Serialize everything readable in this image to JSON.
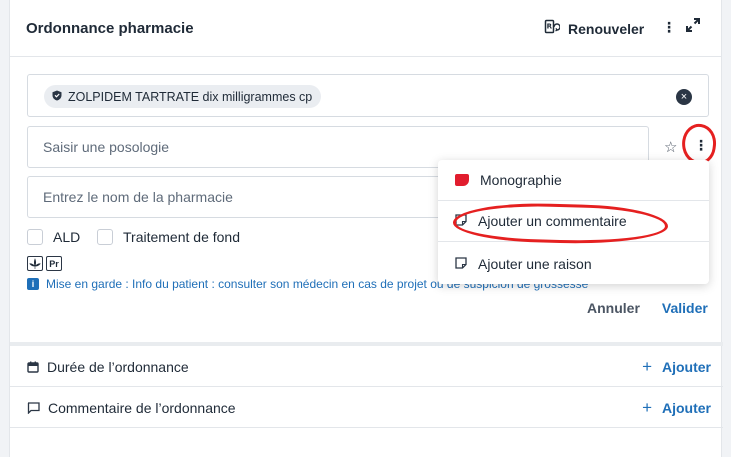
{
  "header": {
    "title": "Ordonnance pharmacie",
    "renew_label": "Renouveler"
  },
  "medication": {
    "name": "ZOLPIDEM TARTRATE dix milligrammes cp"
  },
  "posology": {
    "placeholder": "Saisir une posologie"
  },
  "pharmacy": {
    "placeholder": "Entrez le nom de la pharmacie"
  },
  "checkboxes": {
    "ald_label": "ALD",
    "fond_label": "Traitement de fond"
  },
  "badges": {
    "pr": "Pr"
  },
  "warning": {
    "text": "Mise en garde : Info du patient : consulter son médecin en cas de projet ou de suspicion de grossesse"
  },
  "actions": {
    "cancel": "Annuler",
    "validate": "Valider"
  },
  "sections": [
    {
      "label": "Durée de l’ordonnance",
      "add": "Ajouter"
    },
    {
      "label": "Commentaire de l’ordonnance",
      "add": "Ajouter"
    }
  ],
  "menu": {
    "items": [
      {
        "label": "Monographie"
      },
      {
        "label": "Ajouter un commentaire"
      },
      {
        "label": "Ajouter une raison"
      }
    ]
  },
  "colors": {
    "accent": "#1f6fb8",
    "annotation": "#e52020",
    "monograph": "#e11d2e"
  }
}
